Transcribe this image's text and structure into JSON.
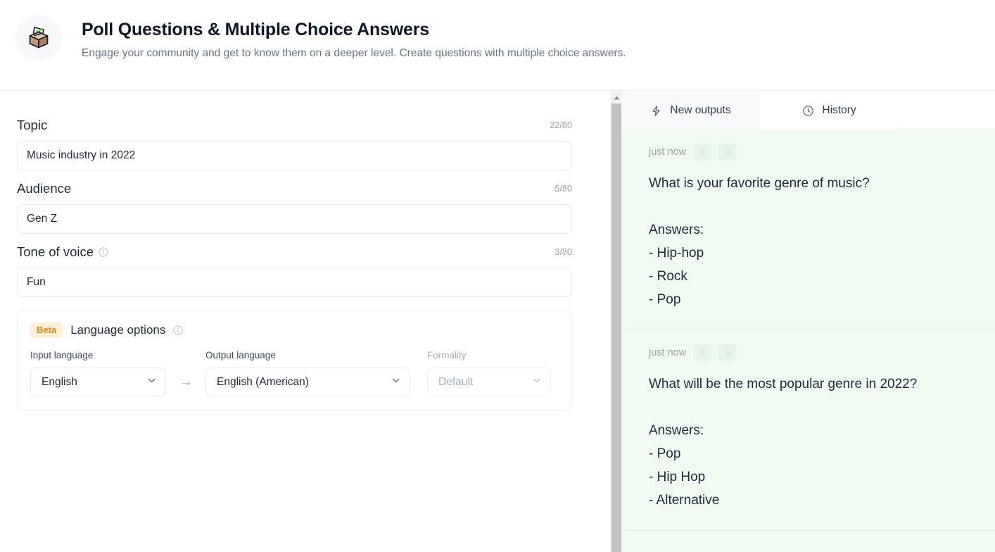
{
  "header": {
    "icon": "ballot-box-icon",
    "title": "Poll Questions & Multiple Choice Answers",
    "subtitle": "Engage your community and get to know them on a deeper level. Create questions with multiple choice answers."
  },
  "form": {
    "fields": [
      {
        "label": "Topic",
        "counter": "22/80",
        "value": "Music industry in 2022",
        "placeholder": "",
        "has_info": false
      },
      {
        "label": "Audience",
        "counter": "5/80",
        "value": "Gen Z",
        "placeholder": "",
        "has_info": false
      },
      {
        "label": "Tone of voice",
        "counter": "3/80",
        "value": "Fun",
        "placeholder": "",
        "has_info": true
      }
    ],
    "language_options": {
      "badge": "Beta",
      "title": "Language options",
      "info_icon": "info-icon",
      "input_language": {
        "label": "Input language",
        "value": "English"
      },
      "arrow": "→",
      "output_language": {
        "label": "Output language",
        "value": "English (American)"
      },
      "formality": {
        "label": "Formality",
        "value": "Default",
        "disabled": true
      }
    }
  },
  "right_panel": {
    "tabs": [
      {
        "label": "New outputs",
        "icon": "lightning-bolt-icon",
        "active": true
      },
      {
        "label": "History",
        "icon": "clock-icon",
        "active": false
      }
    ],
    "outputs": [
      {
        "time": "just now",
        "star_icon": "star-icon",
        "copy_icon": "copy-icon",
        "text": "What is your favorite genre of music?\n\nAnswers:\n- Hip-hop\n- Rock\n- Pop"
      },
      {
        "time": "just now",
        "star_icon": "star-icon",
        "copy_icon": "copy-icon",
        "text": "What will be the most popular genre in 2022?\n\nAnswers:\n- Pop\n- Hip Hop\n- Alternative"
      }
    ]
  },
  "colors": {
    "output_background": "#f0faf1",
    "beta_badge_bg": "#fdf0d5",
    "beta_badge_text": "#d98a17",
    "text_primary": "#1e293b",
    "text_muted": "#64748b",
    "border": "#e4e9f2"
  },
  "scrollbar": {
    "position": "right-of-left-panel",
    "thumb_color": "#c1c1c1"
  }
}
